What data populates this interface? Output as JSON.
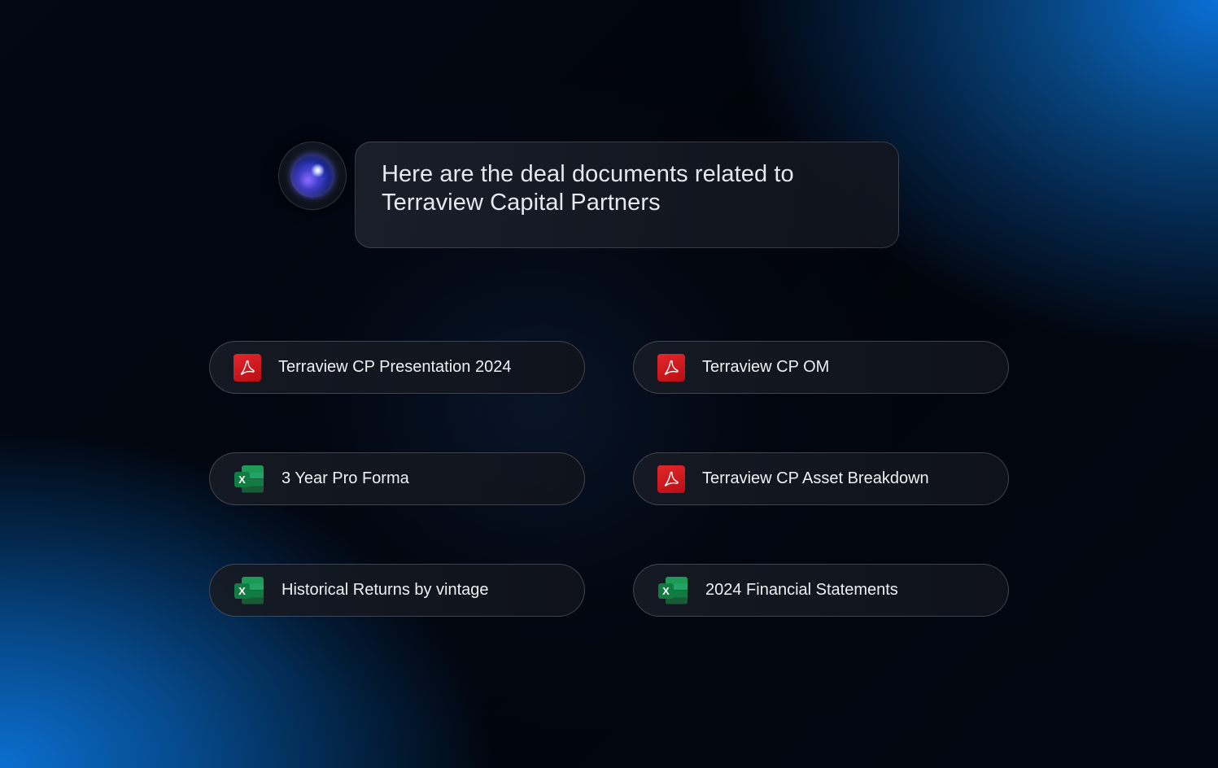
{
  "assistant": {
    "avatar_icon": "ai-orb-icon",
    "message": "Here are the deal documents related to Terraview Capital Partners"
  },
  "documents": [
    {
      "label": "Terraview CP Presentation 2024",
      "type": "pdf",
      "icon": "pdf-icon"
    },
    {
      "label": "Terraview CP OM",
      "type": "pdf",
      "icon": "pdf-icon"
    },
    {
      "label": "3 Year Pro Forma",
      "type": "xlsx",
      "icon": "excel-icon"
    },
    {
      "label": "Terraview CP Asset Breakdown",
      "type": "pdf",
      "icon": "pdf-icon"
    },
    {
      "label": "Historical Returns by vintage",
      "type": "xlsx",
      "icon": "excel-icon"
    },
    {
      "label": "2024 Financial Statements",
      "type": "xlsx",
      "icon": "excel-icon"
    }
  ],
  "icons": {
    "excel_badge": "X"
  },
  "colors": {
    "background": "#01040b",
    "accent_blue": "#0a6fd6",
    "pdf_red": "#d11a20",
    "excel_green": "#107c41",
    "text": "#eef0f4"
  }
}
